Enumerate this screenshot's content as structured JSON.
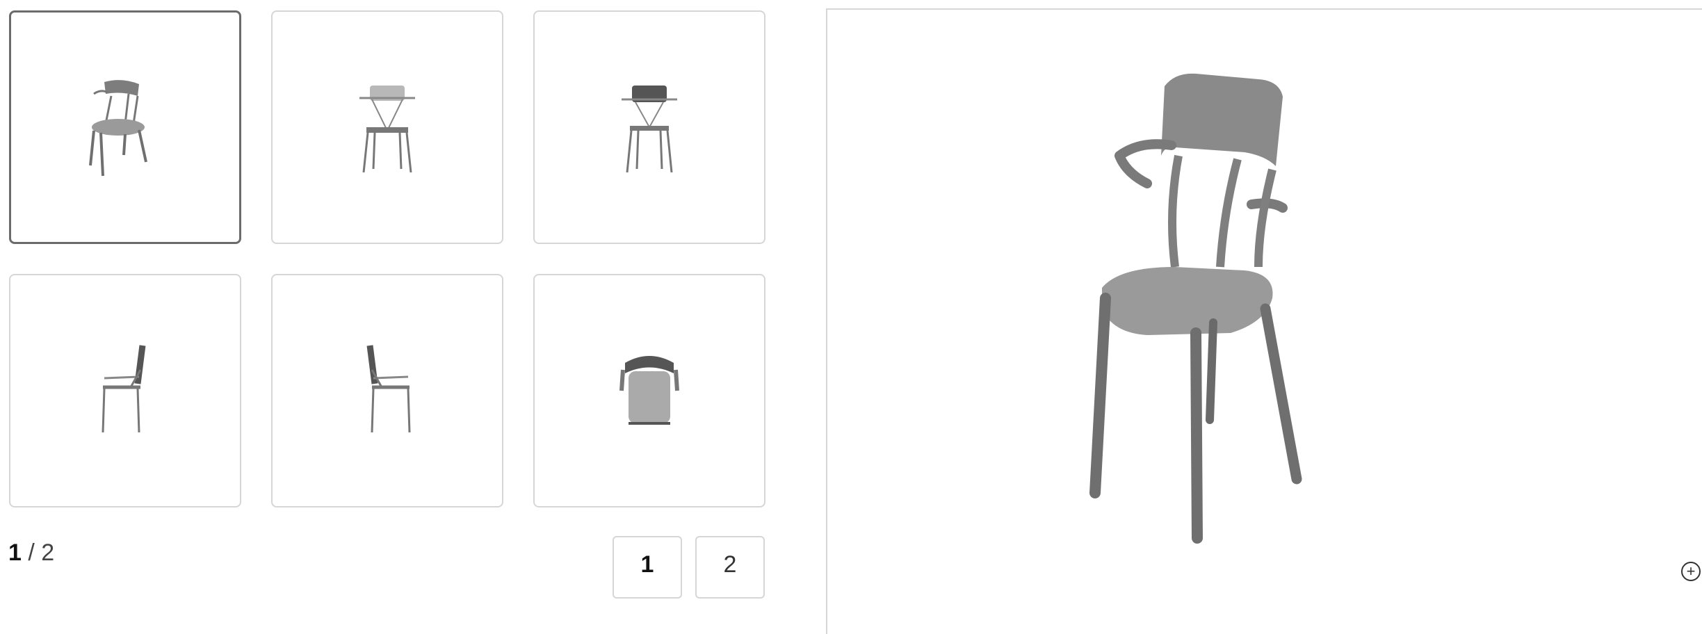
{
  "gallery": {
    "thumbnails": [
      {
        "view": "three-quarter",
        "selected": true
      },
      {
        "view": "front",
        "selected": false
      },
      {
        "view": "back",
        "selected": false
      },
      {
        "view": "side-left",
        "selected": false
      },
      {
        "view": "side-right",
        "selected": false
      },
      {
        "view": "top",
        "selected": false
      }
    ],
    "counter": {
      "current": "1",
      "separator": " / ",
      "total": "2"
    },
    "pages": [
      "1",
      "2"
    ],
    "active_page": "1"
  },
  "viewer": {
    "zoom_icon": "zoom-in-icon",
    "zoom_symbol": "+"
  },
  "colors": {
    "chair": "#8a8a8a",
    "chair_dark": "#5e5e5e",
    "border": "#d6d6d6",
    "selected_border": "#6b6b6b"
  }
}
